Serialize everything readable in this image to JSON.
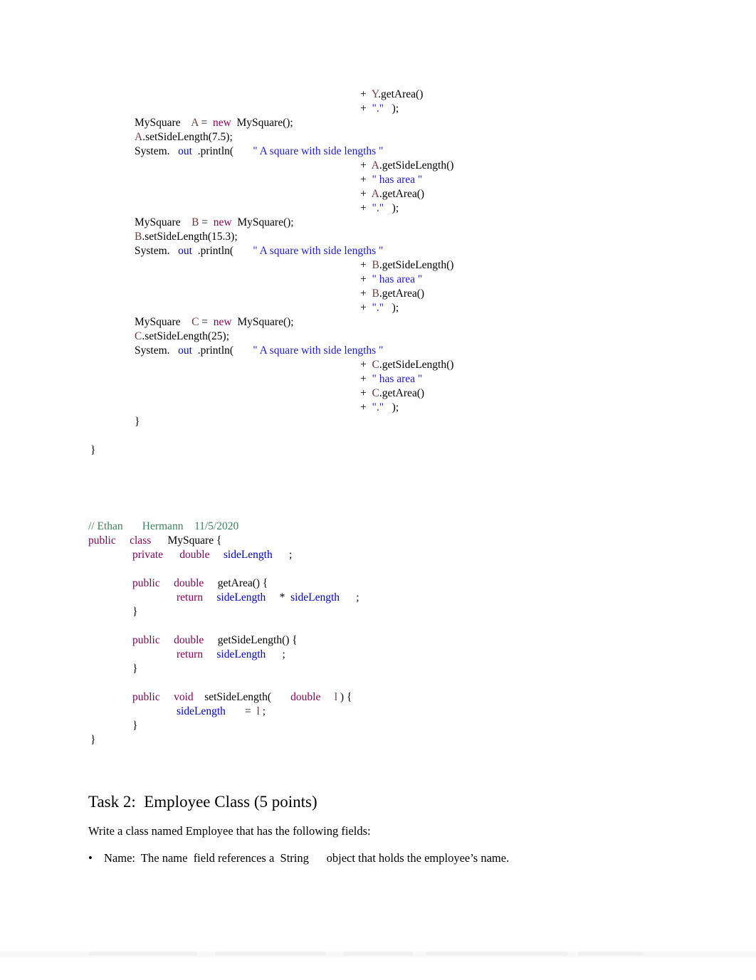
{
  "document": {
    "type": "word-processor-page",
    "background": "#ffffff"
  },
  "theme": {
    "keyword_color": "#7F0055",
    "string_color": "#2020C0",
    "field_color": "#0000C0",
    "object_ref_color": "#6E3B3B",
    "comment_color": "#3F7F5F",
    "plain_color": "#000000"
  },
  "code_block_top": {
    "name": "tester-class-tail",
    "lines": [
      {
        "indent": 382,
        "tokens": [
          {
            "t": "+  ",
            "c": "plain"
          },
          {
            "t": "Y",
            "c": "var"
          },
          {
            "t": ".getArea()",
            "c": "plain"
          }
        ]
      },
      {
        "indent": 382,
        "tokens": [
          {
            "t": "+  ",
            "c": "plain"
          },
          {
            "t": "\".\"",
            "c": "str"
          },
          {
            "t": "   );",
            "c": "plain"
          }
        ]
      },
      {
        "indent": 65,
        "tokens": [
          {
            "t": "MySquare    ",
            "c": "plain"
          },
          {
            "t": "A",
            "c": "var"
          },
          {
            "t": " =  ",
            "c": "plain"
          },
          {
            "t": "new",
            "c": "kw"
          },
          {
            "t": "  MySquare();",
            "c": "plain"
          }
        ]
      },
      {
        "indent": 65,
        "tokens": [
          {
            "t": "A",
            "c": "var"
          },
          {
            "t": ".setSideLength(7.5);",
            "c": "plain"
          }
        ]
      },
      {
        "indent": 65,
        "tokens": [
          {
            "t": "System.   ",
            "c": "plain"
          },
          {
            "t": "out",
            "c": "field"
          },
          {
            "t": "  .println(       ",
            "c": "plain"
          },
          {
            "t": "\" A square with side lengths \"",
            "c": "str"
          }
        ]
      },
      {
        "indent": 382,
        "tokens": [
          {
            "t": "+  ",
            "c": "plain"
          },
          {
            "t": "A",
            "c": "var"
          },
          {
            "t": ".getSideLength()",
            "c": "plain"
          }
        ]
      },
      {
        "indent": 382,
        "tokens": [
          {
            "t": "+  ",
            "c": "plain"
          },
          {
            "t": "\" has area \"",
            "c": "str"
          }
        ]
      },
      {
        "indent": 382,
        "tokens": [
          {
            "t": "+  ",
            "c": "plain"
          },
          {
            "t": "A",
            "c": "var"
          },
          {
            "t": ".getArea()",
            "c": "plain"
          }
        ]
      },
      {
        "indent": 382,
        "tokens": [
          {
            "t": "+  ",
            "c": "plain"
          },
          {
            "t": "\".\"",
            "c": "str"
          },
          {
            "t": "   );",
            "c": "plain"
          }
        ]
      },
      {
        "indent": 65,
        "tokens": [
          {
            "t": "MySquare    ",
            "c": "plain"
          },
          {
            "t": "B",
            "c": "var"
          },
          {
            "t": " =  ",
            "c": "plain"
          },
          {
            "t": "new",
            "c": "kw"
          },
          {
            "t": "  MySquare();",
            "c": "plain"
          }
        ]
      },
      {
        "indent": 65,
        "tokens": [
          {
            "t": "B",
            "c": "var"
          },
          {
            "t": ".setSideLength(15.3);",
            "c": "plain"
          }
        ]
      },
      {
        "indent": 65,
        "tokens": [
          {
            "t": "System.   ",
            "c": "plain"
          },
          {
            "t": "out",
            "c": "field"
          },
          {
            "t": "  .println(       ",
            "c": "plain"
          },
          {
            "t": "\" A square with side lengths \"",
            "c": "str"
          }
        ]
      },
      {
        "indent": 382,
        "tokens": [
          {
            "t": "+  ",
            "c": "plain"
          },
          {
            "t": "B",
            "c": "var"
          },
          {
            "t": ".getSideLength()",
            "c": "plain"
          }
        ]
      },
      {
        "indent": 382,
        "tokens": [
          {
            "t": "+  ",
            "c": "plain"
          },
          {
            "t": "\" has area \"",
            "c": "str"
          }
        ]
      },
      {
        "indent": 382,
        "tokens": [
          {
            "t": "+  ",
            "c": "plain"
          },
          {
            "t": "B",
            "c": "var"
          },
          {
            "t": ".getArea()",
            "c": "plain"
          }
        ]
      },
      {
        "indent": 382,
        "tokens": [
          {
            "t": "+  ",
            "c": "plain"
          },
          {
            "t": "\".\"",
            "c": "str"
          },
          {
            "t": "   );",
            "c": "plain"
          }
        ]
      },
      {
        "indent": 65,
        "tokens": [
          {
            "t": "MySquare    ",
            "c": "plain"
          },
          {
            "t": "C",
            "c": "var"
          },
          {
            "t": " =  ",
            "c": "plain"
          },
          {
            "t": "new",
            "c": "kw"
          },
          {
            "t": "  MySquare();",
            "c": "plain"
          }
        ]
      },
      {
        "indent": 65,
        "tokens": [
          {
            "t": "C",
            "c": "var"
          },
          {
            "t": ".setSideLength(25);",
            "c": "plain"
          }
        ]
      },
      {
        "indent": 65,
        "tokens": [
          {
            "t": "System.   ",
            "c": "plain"
          },
          {
            "t": "out",
            "c": "field"
          },
          {
            "t": "  .println(       ",
            "c": "plain"
          },
          {
            "t": "\" A square with side lengths \"",
            "c": "str"
          }
        ]
      },
      {
        "indent": 382,
        "tokens": [
          {
            "t": "+  ",
            "c": "plain"
          },
          {
            "t": "C",
            "c": "var"
          },
          {
            "t": ".getSideLength()",
            "c": "plain"
          }
        ]
      },
      {
        "indent": 382,
        "tokens": [
          {
            "t": "+  ",
            "c": "plain"
          },
          {
            "t": "\" has area \"",
            "c": "str"
          }
        ]
      },
      {
        "indent": 382,
        "tokens": [
          {
            "t": "+  ",
            "c": "plain"
          },
          {
            "t": "C",
            "c": "var"
          },
          {
            "t": ".getArea()",
            "c": "plain"
          }
        ]
      },
      {
        "indent": 382,
        "tokens": [
          {
            "t": "+  ",
            "c": "plain"
          },
          {
            "t": "\".\"",
            "c": "str"
          },
          {
            "t": "   );",
            "c": "plain"
          }
        ]
      },
      {
        "indent": 65,
        "tokens": [
          {
            "t": "}",
            "c": "plain"
          }
        ]
      },
      {
        "indent": 0,
        "tokens": []
      },
      {
        "indent": 3,
        "tokens": [
          {
            "t": "}",
            "c": "plain"
          }
        ]
      }
    ]
  },
  "code_block_bottom": {
    "name": "mysquare-class",
    "lines": [
      {
        "indent": 0,
        "tokens": [
          {
            "t": "// Ethan       Hermann    11/5/2020",
            "c": "cmt"
          }
        ]
      },
      {
        "indent": 0,
        "tokens": [
          {
            "t": "public",
            "c": "kw"
          },
          {
            "t": "     ",
            "c": "plain"
          },
          {
            "t": "class",
            "c": "kw"
          },
          {
            "t": "      MySquare {",
            "c": "plain"
          }
        ]
      },
      {
        "indent": 62,
        "tokens": [
          {
            "t": "private",
            "c": "kw"
          },
          {
            "t": "      ",
            "c": "plain"
          },
          {
            "t": "double",
            "c": "kw"
          },
          {
            "t": "     ",
            "c": "plain"
          },
          {
            "t": "sideLength",
            "c": "field"
          },
          {
            "t": "      ;",
            "c": "plain"
          }
        ]
      },
      {
        "indent": 0,
        "tokens": []
      },
      {
        "indent": 62,
        "tokens": [
          {
            "t": "public",
            "c": "kw"
          },
          {
            "t": "     ",
            "c": "plain"
          },
          {
            "t": "double",
            "c": "kw"
          },
          {
            "t": "     getArea() {",
            "c": "plain"
          }
        ]
      },
      {
        "indent": 124,
        "tokens": [
          {
            "t": "return",
            "c": "kw"
          },
          {
            "t": "     ",
            "c": "plain"
          },
          {
            "t": "sideLength",
            "c": "field"
          },
          {
            "t": "     *  ",
            "c": "plain"
          },
          {
            "t": "sideLength",
            "c": "field"
          },
          {
            "t": "      ;",
            "c": "plain"
          }
        ]
      },
      {
        "indent": 62,
        "tokens": [
          {
            "t": "}",
            "c": "plain"
          }
        ]
      },
      {
        "indent": 0,
        "tokens": []
      },
      {
        "indent": 62,
        "tokens": [
          {
            "t": "public",
            "c": "kw"
          },
          {
            "t": "     ",
            "c": "plain"
          },
          {
            "t": "double",
            "c": "kw"
          },
          {
            "t": "     getSideLength() {",
            "c": "plain"
          }
        ]
      },
      {
        "indent": 124,
        "tokens": [
          {
            "t": "return",
            "c": "kw"
          },
          {
            "t": "     ",
            "c": "plain"
          },
          {
            "t": "sideLength",
            "c": "field"
          },
          {
            "t": "      ;",
            "c": "plain"
          }
        ]
      },
      {
        "indent": 62,
        "tokens": [
          {
            "t": "}",
            "c": "plain"
          }
        ]
      },
      {
        "indent": 0,
        "tokens": []
      },
      {
        "indent": 62,
        "tokens": [
          {
            "t": "public",
            "c": "kw"
          },
          {
            "t": "     ",
            "c": "plain"
          },
          {
            "t": "void",
            "c": "kw"
          },
          {
            "t": "    setSideLength(       ",
            "c": "plain"
          },
          {
            "t": "double",
            "c": "kw"
          },
          {
            "t": "     ",
            "c": "plain"
          },
          {
            "t": "l",
            "c": "var"
          },
          {
            "t": " ) {",
            "c": "plain"
          }
        ]
      },
      {
        "indent": 124,
        "tokens": [
          {
            "t": "sideLength",
            "c": "field"
          },
          {
            "t": "       =  ",
            "c": "plain"
          },
          {
            "t": "l",
            "c": "var"
          },
          {
            "t": " ;",
            "c": "plain"
          }
        ]
      },
      {
        "indent": 62,
        "tokens": [
          {
            "t": "}",
            "c": "plain"
          }
        ]
      },
      {
        "indent": 3,
        "tokens": [
          {
            "t": "}",
            "c": "plain"
          }
        ]
      }
    ]
  },
  "task_section": {
    "heading": "Task 2:  Employee Class (5 points)",
    "intro": "Write a class named Employee that has the following fields:",
    "bullets": [
      {
        "mark": "•",
        "text": "Name:  The name  field references a  String      object that holds the employee’s name."
      }
    ]
  }
}
